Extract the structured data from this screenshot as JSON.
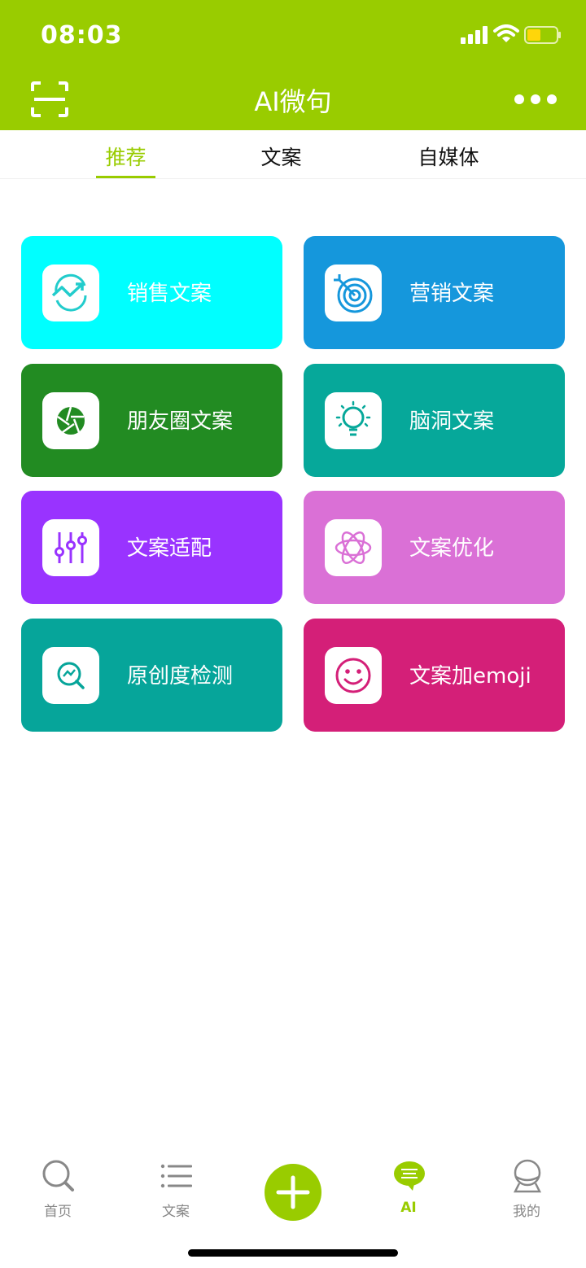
{
  "status_bar": {
    "time": "08:03"
  },
  "header": {
    "title": "AI微句"
  },
  "tabs": [
    {
      "label": "推荐",
      "active": true
    },
    {
      "label": "文案",
      "active": false
    },
    {
      "label": "自媒体",
      "active": false
    }
  ],
  "cards": [
    {
      "label": "销售文案",
      "color": "#00ffff",
      "icon": "trend-icon"
    },
    {
      "label": "营销文案",
      "color": "#1597dc",
      "icon": "target-icon"
    },
    {
      "label": "朋友圈文案",
      "color": "#228b22",
      "icon": "aperture-icon"
    },
    {
      "label": "脑洞文案",
      "color": "#06a89a",
      "icon": "lightbulb-icon"
    },
    {
      "label": "文案适配",
      "color": "#9933ff",
      "icon": "sliders-icon"
    },
    {
      "label": "文案优化",
      "color": "#da70d6",
      "icon": "atom-icon"
    },
    {
      "label": "原创度检测",
      "color": "#06a59a",
      "icon": "magnifier-chart-icon"
    },
    {
      "label": "文案加emoji",
      "color": "#d41f78",
      "icon": "smiley-icon"
    }
  ],
  "bottom_nav": [
    {
      "label": "首页",
      "icon": "search-icon",
      "active": false
    },
    {
      "label": "文案",
      "icon": "list-icon",
      "active": false
    },
    {
      "label": "AI",
      "icon": "chat-icon",
      "active": true
    },
    {
      "label": "我的",
      "icon": "user-icon",
      "active": false
    }
  ],
  "colors": {
    "brand": "#99cc00",
    "inactive": "#888888"
  }
}
